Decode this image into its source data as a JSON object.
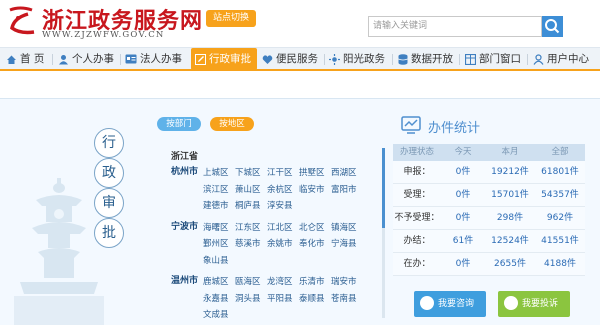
{
  "header": {
    "site_title": "浙江政务服务网",
    "site_domain": "WWW.ZJZWFW.GOV.CN",
    "site_switch_label": "站点切换",
    "search": {
      "placeholder": "请输入关键词"
    }
  },
  "nav": {
    "items": [
      {
        "label": "首 页",
        "icon": "home-icon"
      },
      {
        "label": "个人办事",
        "icon": "person-icon"
      },
      {
        "label": "法人办事",
        "icon": "id-card-icon"
      },
      {
        "label": "行政审批",
        "icon": "edit-icon",
        "active": true
      },
      {
        "label": "便民服务",
        "icon": "heart-icon"
      },
      {
        "label": "阳光政务",
        "icon": "sun-icon"
      },
      {
        "label": "数据开放",
        "icon": "database-icon"
      },
      {
        "label": "部门窗口",
        "icon": "window-icon"
      },
      {
        "label": "用户中心",
        "icon": "user-icon"
      }
    ]
  },
  "page": {
    "vertical_title": [
      "行",
      "政",
      "审",
      "批"
    ],
    "tabs": {
      "dept": "按部门",
      "region": "按地区"
    }
  },
  "regions": {
    "province": "浙江省",
    "cities": [
      {
        "name": "杭州市",
        "districts": [
          "上城区",
          "下城区",
          "江干区",
          "拱墅区",
          "西湖区",
          "滨江区",
          "萧山区",
          "余杭区",
          "临安市",
          "富阳市",
          "建德市",
          "桐庐县",
          "淳安县"
        ]
      },
      {
        "name": "宁波市",
        "districts": [
          "海曙区",
          "江东区",
          "江北区",
          "北仑区",
          "镇海区",
          "鄞州区",
          "慈溪市",
          "余姚市",
          "奉化市",
          "宁海县",
          "象山县"
        ]
      },
      {
        "name": "温州市",
        "districts": [
          "鹿城区",
          "瓯海区",
          "龙湾区",
          "乐清市",
          "瑞安市",
          "永嘉县",
          "洞头县",
          "平阳县",
          "泰顺县",
          "苍南县",
          "文成县"
        ]
      }
    ]
  },
  "stats": {
    "title": "办件统计",
    "headers": [
      "办理状态",
      "今天",
      "本月",
      "全部"
    ],
    "rows": [
      {
        "label": "申报：",
        "today": "0件",
        "month": "19212件",
        "all": "61801件"
      },
      {
        "label": "受理：",
        "today": "0件",
        "month": "15701件",
        "all": "54357件"
      },
      {
        "label": "不予受理：",
        "today": "0件",
        "month": "298件",
        "all": "962件"
      },
      {
        "label": "办结：",
        "today": "61件",
        "month": "12524件",
        "all": "41551件"
      },
      {
        "label": "在办：",
        "today": "0件",
        "month": "2655件",
        "all": "4188件"
      }
    ]
  },
  "actions": {
    "consult": "我要咨询",
    "complain": "我要投诉"
  },
  "colors": {
    "accent": "#f7a21b",
    "brand_red": "#c8171e",
    "link_blue": "#2b5e91",
    "stat_blue": "#4f8fcf"
  }
}
